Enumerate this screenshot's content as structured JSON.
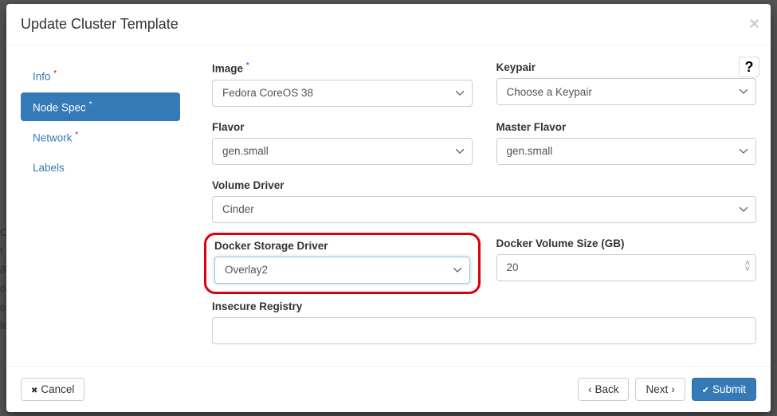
{
  "backdrop": [
    "O",
    "t",
    "/P",
    "ol",
    "ol",
    "le"
  ],
  "modal_title": "Update Cluster Template",
  "help_glyph": "?",
  "sidebar": {
    "items": [
      {
        "label": "Info",
        "required": true,
        "active": false
      },
      {
        "label": "Node Spec",
        "required": true,
        "active": true
      },
      {
        "label": "Network",
        "required": true,
        "active": false
      },
      {
        "label": "Labels",
        "required": false,
        "active": false
      }
    ]
  },
  "form": {
    "image": {
      "label": "Image",
      "required": true,
      "value": "Fedora CoreOS 38"
    },
    "keypair": {
      "label": "Keypair",
      "required": false,
      "value": "Choose a Keypair"
    },
    "flavor": {
      "label": "Flavor",
      "required": false,
      "value": "gen.small"
    },
    "master_flavor": {
      "label": "Master Flavor",
      "required": false,
      "value": "gen.small"
    },
    "volume_driver": {
      "label": "Volume Driver",
      "required": false,
      "value": "Cinder"
    },
    "docker_storage_driver": {
      "label": "Docker Storage Driver",
      "required": false,
      "value": "Overlay2"
    },
    "docker_volume_size": {
      "label": "Docker Volume Size (GB)",
      "required": false,
      "value": "20"
    },
    "insecure_registry": {
      "label": "Insecure Registry",
      "required": false,
      "value": ""
    }
  },
  "footer": {
    "cancel": "Cancel",
    "back": "Back",
    "next": "Next",
    "submit": "Submit"
  }
}
